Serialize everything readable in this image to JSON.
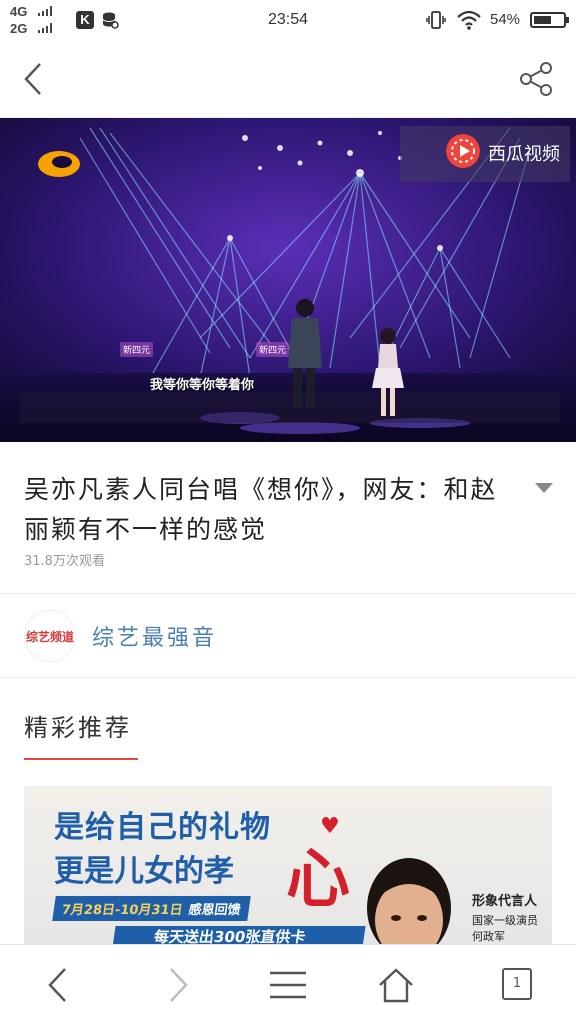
{
  "status_bar": {
    "net1": "4G",
    "net2": "2G",
    "app_k": "K",
    "time": "23:54",
    "battery": "54%",
    "battery_level": 0.54
  },
  "nav": {
    "back_icon": "chevron-left-icon",
    "share_icon": "share-icon"
  },
  "video": {
    "watermark": "西瓜视频",
    "subtitle": "我等你等你等着你",
    "name_tag_left": "新四元",
    "name_tag_right": "新四元"
  },
  "article": {
    "title": "吴亦凡素人同台唱《想你》，网友：和赵丽颖有不一样的感觉",
    "views": "31.8万次观看"
  },
  "channel": {
    "logo_text": "综艺频道",
    "name": "综艺最强音"
  },
  "recommend": {
    "heading": "精彩推荐",
    "ad": {
      "line1": "是给自己的礼物",
      "line2": "更是儿女的孝",
      "big_char": "心",
      "date": "7月28日-10月31日",
      "date_tag": "感恩回馈",
      "ribbon2": "每天送出300张直供卡",
      "spokesperson_title": "形象代言人",
      "spokesperson_desc": "国家一级演员",
      "spokesperson_name": "何政军"
    }
  },
  "bottom_nav": {
    "tab_count": "1"
  },
  "colors": {
    "accent_red": "#e2483c",
    "channel_blue": "#4a7fb5",
    "ad_blue": "#1f5ea8"
  }
}
